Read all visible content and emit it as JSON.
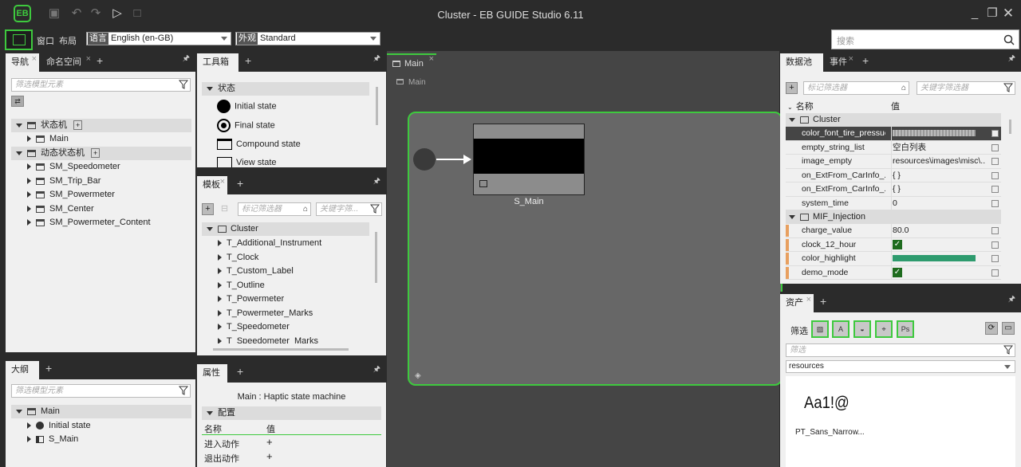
{
  "window": {
    "title": "Cluster - EB GUIDE Studio 6.11"
  },
  "menu": {
    "window": "窗口",
    "layout": "布局",
    "language_label": "语言",
    "language_value": "English (en-GB)",
    "appearance_label": "外观",
    "appearance_value": "Standard",
    "search_placeholder": "搜索"
  },
  "nav": {
    "tabs": [
      "导航",
      "命名空间"
    ],
    "filter_placeholder": "筛选模型元素",
    "state_machines_label": "状态机",
    "main_item": "Main",
    "dynamic_label": "动态状态机",
    "dynamic_items": [
      "SM_Speedometer",
      "SM_Trip_Bar",
      "SM_Powermeter",
      "SM_Center",
      "SM_Powermeter_Content"
    ]
  },
  "outline": {
    "tab": "大纲",
    "filter_placeholder": "筛选模型元素",
    "root": "Main",
    "items": [
      "Initial state",
      "S_Main"
    ]
  },
  "toolbox": {
    "tab": "工具箱",
    "section": "状态",
    "items": [
      "Initial state",
      "Final state",
      "Compound state",
      "View state"
    ]
  },
  "templates": {
    "tab": "模板",
    "tag_filter": "标记筛选器",
    "kw_filter": "关键字筛...",
    "group": "Cluster",
    "items": [
      "T_Additional_Instrument",
      "T_Clock",
      "T_Custom_Label",
      "T_Outline",
      "T_Powermeter",
      "T_Powermeter_Marks",
      "T_Speedometer",
      "T_Speedometer_Marks"
    ]
  },
  "properties": {
    "tab": "属性",
    "subtitle": "Main : Haptic state machine",
    "section": "配置",
    "col_name": "名称",
    "col_value": "值",
    "rows": [
      {
        "name": "进入动作",
        "value": "+"
      },
      {
        "name": "退出动作",
        "value": "+"
      }
    ]
  },
  "editor": {
    "tab": "Main",
    "breadcrumb": "Main",
    "state_label": "S_Main"
  },
  "datapool": {
    "tabs": [
      "数据池",
      "事件"
    ],
    "tag_filter": "标记筛选器",
    "kw_filter": "关键字筛选器",
    "col_name": "名称",
    "col_value": "值",
    "group1": "Cluster",
    "rows1": [
      {
        "name": "color_font_tire_pressue",
        "value": "",
        "kind": "color",
        "color": "#a8a8a8"
      },
      {
        "name": "empty_string_list",
        "value": "空白列表",
        "kind": "text"
      },
      {
        "name": "image_empty",
        "value": "resources\\images\\misc\\...",
        "kind": "text"
      },
      {
        "name": "on_ExtFrom_CarInfo_...",
        "value": "{ }",
        "kind": "text"
      },
      {
        "name": "on_ExtFrom_CarInfo_...",
        "value": "{ }",
        "kind": "text"
      },
      {
        "name": "system_time",
        "value": "0",
        "kind": "text"
      }
    ],
    "group2": "MIF_Injection",
    "rows2": [
      {
        "name": "charge_value",
        "value": "80.0",
        "kind": "text"
      },
      {
        "name": "clock_12_hour",
        "value": "✓",
        "kind": "check"
      },
      {
        "name": "color_highlight",
        "value": "",
        "kind": "color",
        "color": "#2e9b6e"
      },
      {
        "name": "demo_mode",
        "value": "✓",
        "kind": "check"
      }
    ]
  },
  "assets": {
    "tab": "资产",
    "filter_label": "筛选",
    "filter_placeholder": "筛选",
    "folder": "resources",
    "preview_text": "Aa1!@",
    "file_name": "PT_Sans_Narrow..."
  },
  "colors": {
    "accent": "#3ec93e",
    "dark": "#2b2b2b"
  }
}
